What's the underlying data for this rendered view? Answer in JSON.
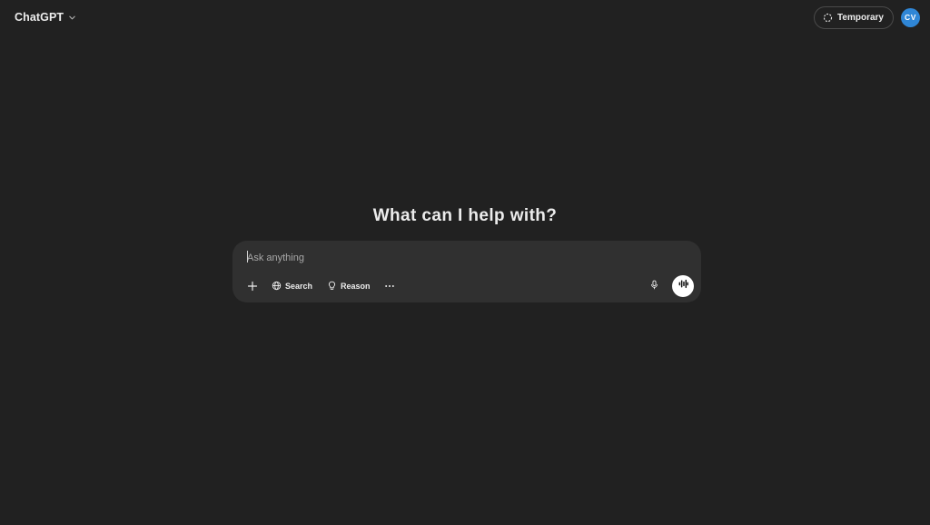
{
  "header": {
    "model_name": "ChatGPT",
    "temporary_label": "Temporary",
    "avatar_initials": "CV",
    "avatar_color": "#2f86d6"
  },
  "main": {
    "headline": "What can I help with?"
  },
  "composer": {
    "placeholder": "Ask anything",
    "value": "",
    "tools": [
      {
        "label": "",
        "icon": "plus-icon"
      },
      {
        "label": "Search",
        "icon": "globe-icon"
      },
      {
        "label": "Reason",
        "icon": "lightbulb-icon"
      },
      {
        "label": "",
        "icon": "more-icon"
      }
    ],
    "mic_icon": "microphone-icon",
    "voice_icon": "voice-waveform-icon"
  },
  "theme": {
    "background": "#212121",
    "composer_bg": "#303030",
    "text": "#ececec"
  }
}
